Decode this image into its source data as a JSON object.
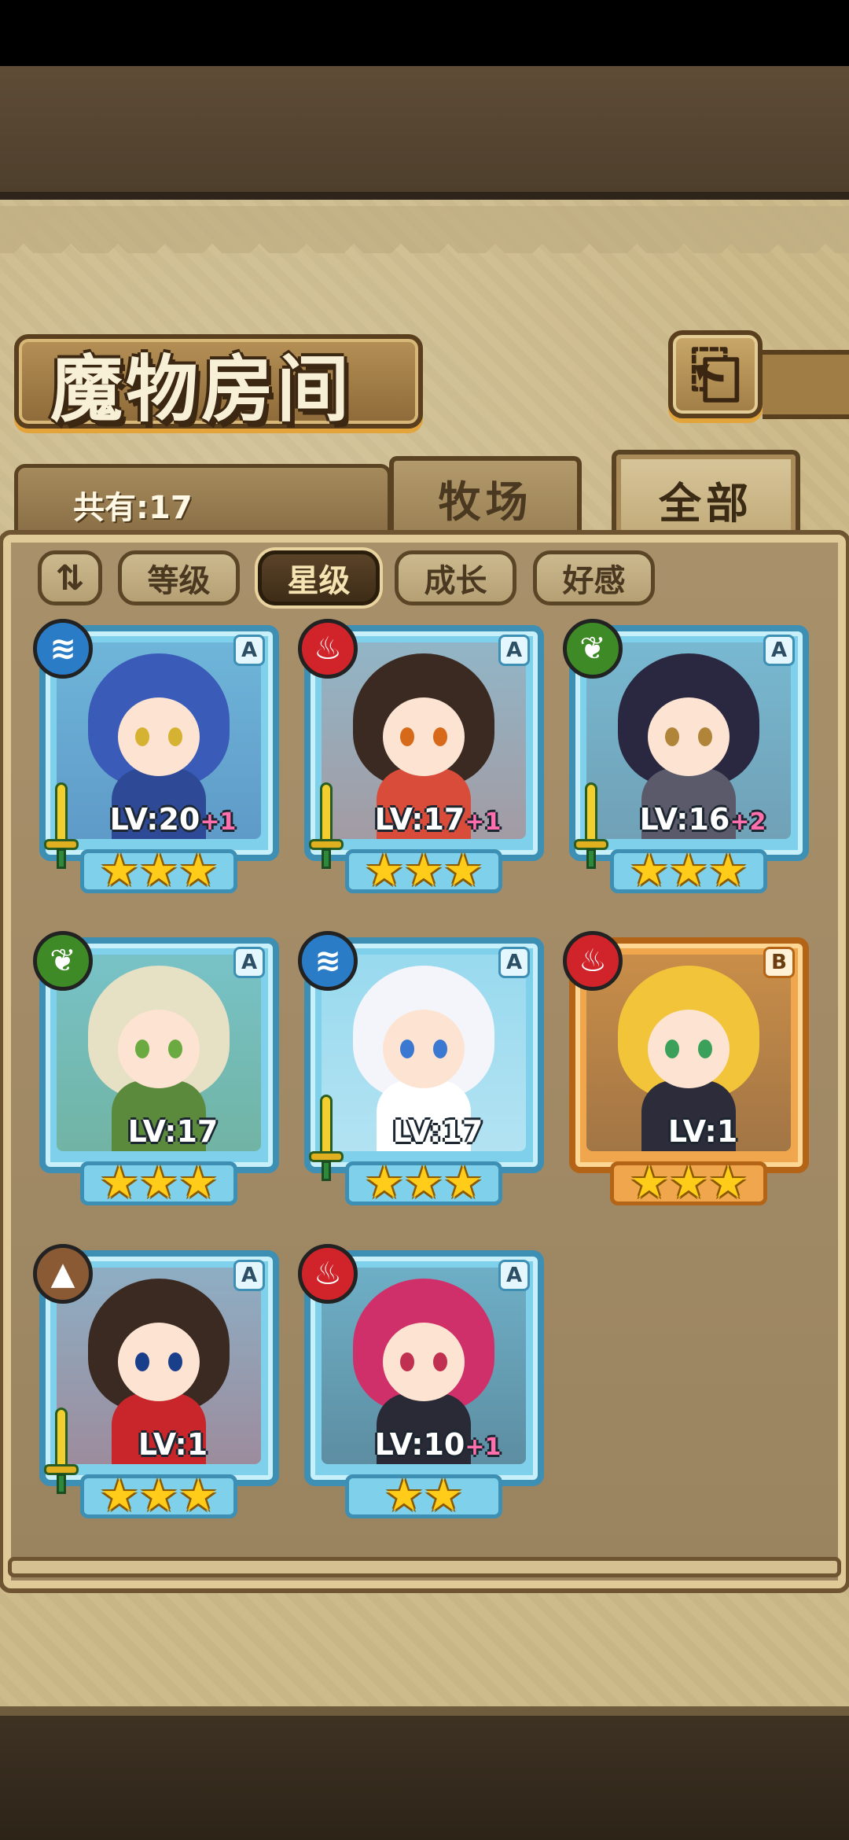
{
  "title": "魔物房间",
  "back_icon": "back-arrow-icon",
  "count_label": "共有:17",
  "tabs": {
    "ranch": "牧场",
    "all": "全部"
  },
  "filters": {
    "sort_toggle": "⇅",
    "items": [
      "等级",
      "星级",
      "成长",
      "好感"
    ],
    "selected": "星级"
  },
  "colors": {
    "water": "#2a7cc7",
    "fire": "#d0242a",
    "leaf": "#3e8a26",
    "earth": "#8a5a35",
    "card_blue": "#7fd0ea",
    "card_orange": "#f0a64c"
  },
  "monsters": [
    {
      "rank": "A",
      "element": "water",
      "level": "LV:20",
      "bonus": "+1",
      "stars": 3,
      "weapon": true
    },
    {
      "rank": "A",
      "element": "fire",
      "level": "LV:17",
      "bonus": "+1",
      "stars": 3,
      "weapon": true
    },
    {
      "rank": "A",
      "element": "leaf",
      "level": "LV:16",
      "bonus": "+2",
      "stars": 3,
      "weapon": true
    },
    {
      "rank": "A",
      "element": "leaf",
      "level": "LV:17",
      "bonus": "",
      "stars": 3,
      "weapon": false
    },
    {
      "rank": "A",
      "element": "water",
      "level": "LV:17",
      "bonus": "",
      "stars": 3,
      "weapon": true
    },
    {
      "rank": "B",
      "element": "fire",
      "level": "LV:1",
      "bonus": "",
      "stars": 3,
      "weapon": false
    },
    {
      "rank": "A",
      "element": "earth",
      "level": "LV:1",
      "bonus": "",
      "stars": 3,
      "weapon": true
    },
    {
      "rank": "A",
      "element": "fire",
      "level": "LV:10",
      "bonus": "+1",
      "stars": 2,
      "weapon": false
    }
  ]
}
